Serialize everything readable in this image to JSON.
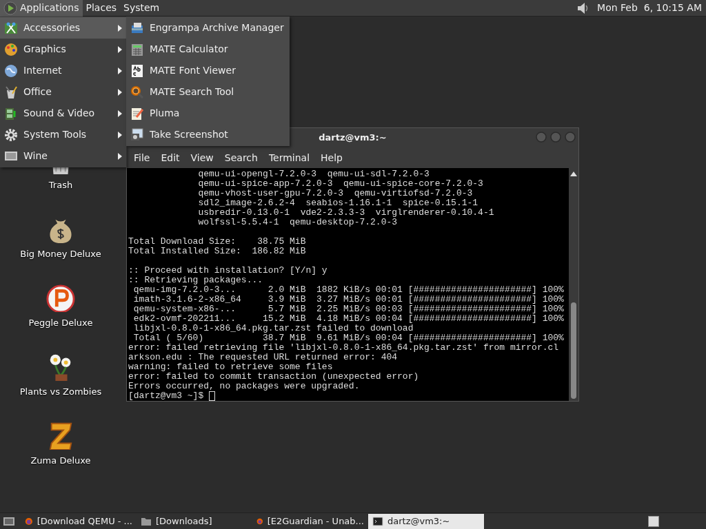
{
  "top_panel": {
    "menus": [
      {
        "label": "Applications",
        "selected": true
      },
      {
        "label": "Places",
        "selected": false
      },
      {
        "label": "System",
        "selected": false
      }
    ],
    "clock": "Mon Feb  6, 10:15 AM"
  },
  "applications_menu": {
    "items": [
      {
        "label": "Accessories",
        "kind": "accessories",
        "selected": true
      },
      {
        "label": "Graphics",
        "kind": "graphics",
        "selected": false
      },
      {
        "label": "Internet",
        "kind": "internet",
        "selected": false
      },
      {
        "label": "Office",
        "kind": "office",
        "selected": false
      },
      {
        "label": "Sound & Video",
        "kind": "sound_video",
        "selected": false
      },
      {
        "label": "System Tools",
        "kind": "system_tools",
        "selected": false
      },
      {
        "label": "Wine",
        "kind": "wine",
        "selected": false
      }
    ]
  },
  "submenu": {
    "items": [
      {
        "label": "Engrampa Archive Manager",
        "kind": "archive"
      },
      {
        "label": "MATE Calculator",
        "kind": "calculator"
      },
      {
        "label": "MATE Font Viewer",
        "kind": "font"
      },
      {
        "label": "MATE Search Tool",
        "kind": "search"
      },
      {
        "label": "Pluma",
        "kind": "editor"
      },
      {
        "label": "Take Screenshot",
        "kind": "screenshot"
      }
    ]
  },
  "desktop_icons": [
    {
      "label": "Trash",
      "kind": "trash"
    },
    {
      "label": "Big Money Deluxe",
      "kind": "money"
    },
    {
      "label": "Peggle Deluxe",
      "kind": "peggle"
    },
    {
      "label": "Plants vs Zombies",
      "kind": "plants"
    },
    {
      "label": "Zuma Deluxe",
      "kind": "zuma"
    }
  ],
  "terminal": {
    "title": "dartz@vm3:~",
    "menu": [
      "File",
      "Edit",
      "View",
      "Search",
      "Terminal",
      "Help"
    ],
    "blocks": [
      [
        "             qemu-ui-opengl-7.2.0-3  qemu-ui-sdl-7.2.0-3",
        "             qemu-ui-spice-app-7.2.0-3  qemu-ui-spice-core-7.2.0-3",
        "             qemu-vhost-user-gpu-7.2.0-3  qemu-virtiofsd-7.2.0-3",
        "             sdl2_image-2.6.2-4  seabios-1.16.1-1  spice-0.15.1-1",
        "             usbredir-0.13.0-1  vde2-2.3.3-3  virglrenderer-0.10.4-1",
        "             wolfssl-5.5.4-1  qemu-desktop-7.2.0-3"
      ],
      [
        "Total Download Size:    38.75 MiB",
        "Total Installed Size:  186.82 MiB"
      ],
      [
        ":: Proceed with installation? [Y/n] y",
        ":: Retrieving packages...",
        " qemu-img-7.2.0-3...      2.0 MiB  1882 KiB/s 00:01 [######################] 100%",
        " imath-3.1.6-2-x86_64     3.9 MiB  3.27 MiB/s 00:01 [######################] 100%",
        " qemu-system-x86-...      5.7 MiB  2.25 MiB/s 00:03 [######################] 100%",
        " edk2-ovmf-202211...     15.2 MiB  4.18 MiB/s 00:04 [######################] 100%",
        " libjxl-0.8.0-1-x86_64.pkg.tar.zst failed to download",
        " Total ( 5/60)           38.7 MiB  9.61 MiB/s 00:04 [######################] 100%",
        "error: failed retrieving file 'libjxl-0.8.0-1-x86_64.pkg.tar.zst' from mirror.cl",
        "arkson.edu : The requested URL returned error: 404",
        "warning: failed to retrieve some files",
        "error: failed to commit transaction (unexpected error)",
        "Errors occurred, no packages were upgraded."
      ]
    ],
    "prompt": "[dartz@vm3 ~]$ "
  },
  "taskbar": {
    "items": [
      {
        "label": "[Download QEMU - ...",
        "kind": "browser",
        "selected": false
      },
      {
        "label": "[Downloads]",
        "kind": "folder",
        "selected": false
      },
      {
        "label": "[E2Guardian - Unab...",
        "kind": "browser",
        "selected": false
      },
      {
        "label": "dartz@vm3:~",
        "kind": "terminal",
        "selected": true
      }
    ]
  }
}
